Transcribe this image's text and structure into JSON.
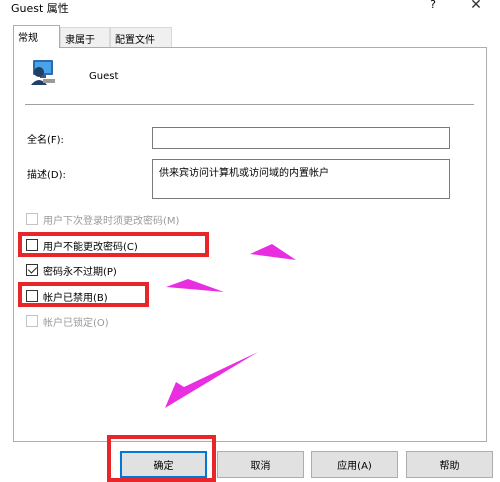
{
  "window": {
    "title": "Guest 属性",
    "help_glyph": "?",
    "close_glyph": "✕"
  },
  "tabs": [
    {
      "label": "常规",
      "active": true
    },
    {
      "label": "隶属于",
      "active": false
    },
    {
      "label": "配置文件",
      "active": false
    }
  ],
  "general": {
    "username": "Guest",
    "fullname_label": "全名(F):",
    "fullname_value": "",
    "description_label": "描述(D):",
    "description_value": "供来宾访问计算机或访问域的内置帐户"
  },
  "checkboxes": [
    {
      "label": "用户下次登录时须更改密码(M)",
      "checked": false,
      "disabled": true
    },
    {
      "label": "用户不能更改密码(C)",
      "checked": false,
      "disabled": false
    },
    {
      "label": "密码永不过期(P)",
      "checked": true,
      "disabled": false
    },
    {
      "label": "帐户已禁用(B)",
      "checked": false,
      "disabled": false
    },
    {
      "label": "帐户已锁定(O)",
      "checked": false,
      "disabled": true
    }
  ],
  "buttons": {
    "ok": "确定",
    "cancel": "取消",
    "apply": "应用(A)",
    "help": "帮助"
  },
  "annotation_colors": {
    "highlight_box": "#e8262a",
    "arrow": "#e82ee0"
  }
}
